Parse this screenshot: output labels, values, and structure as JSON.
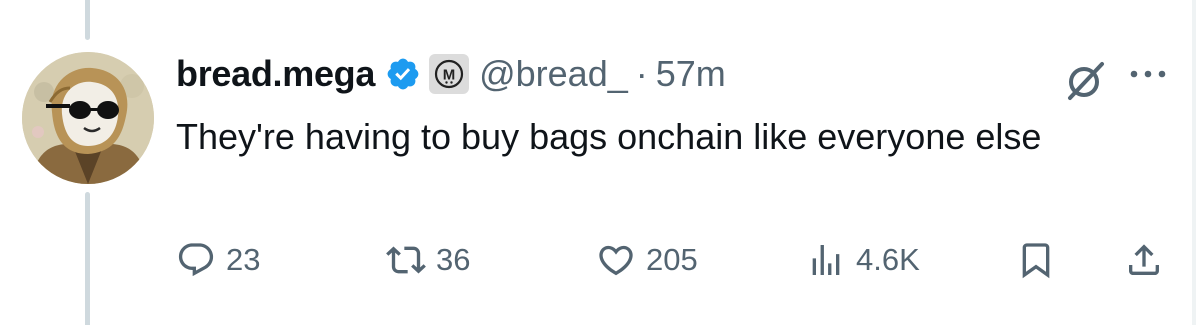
{
  "post": {
    "display_name": "bread.mega",
    "verified": true,
    "affiliate_badge_letter": "M",
    "handle": "@bread_",
    "separator": "·",
    "time": "57m",
    "text": "They're having to buy bags onchain like everyone else"
  },
  "actions": {
    "replies": "23",
    "reposts": "36",
    "likes": "205",
    "views": "4.6K"
  },
  "icons": [
    "reply-icon",
    "repost-icon",
    "like-icon",
    "views-icon",
    "bookmark-icon",
    "share-icon",
    "grok-icon",
    "more-icon",
    "verified-badge-icon"
  ],
  "colors": {
    "verified": "#1d9bf0",
    "muted_text": "#536471",
    "text": "#0f1419",
    "thread_line": "#cfd9de"
  }
}
